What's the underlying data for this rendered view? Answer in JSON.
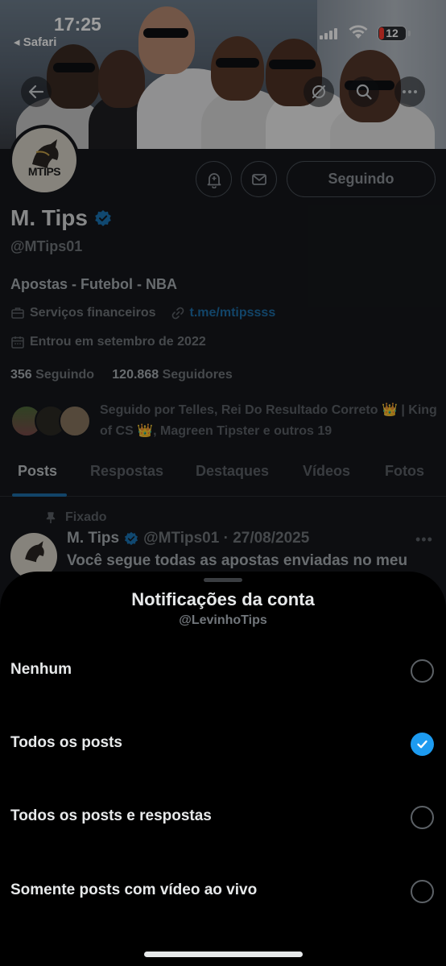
{
  "status_bar": {
    "time": "17:25",
    "back_app": "◂ Safari",
    "battery_level": "12"
  },
  "profile": {
    "avatar_text": "MTIPS",
    "display_name": "M. Tips",
    "handle": "@MTips01",
    "following_button": "Seguindo",
    "bio": "Apostas - Futebol - NBA",
    "category": "Serviços financeiros",
    "link": "t.me/mtipssss",
    "joined": "Entrou em setembro de 2022",
    "following_count": "356",
    "following_label": "Seguindo",
    "followers_count": "120.868",
    "followers_label": "Seguidores",
    "followed_by": "Seguido por Telles, Rei Do Resultado Correto 👑 | King of CS 👑, Magreen Tipster e outros 19"
  },
  "tabs": [
    "Posts",
    "Respostas",
    "Destaques",
    "Vídeos",
    "Fotos"
  ],
  "pinned_post": {
    "pinned_label": "Fixado",
    "author": "M. Tips",
    "meta": "@MTips01 · 27/08/2025",
    "text": "Você segue todas as apostas enviadas no meu"
  },
  "sheet": {
    "title": "Notificações da conta",
    "subtitle": "@LevinhoTips",
    "options": [
      {
        "label": "Nenhum",
        "checked": false
      },
      {
        "label": "Todos os posts",
        "checked": true
      },
      {
        "label": "Todos os posts e respostas",
        "checked": false
      },
      {
        "label": "Somente posts com vídeo ao vivo",
        "checked": false
      }
    ]
  },
  "colors": {
    "accent": "#1d9bf0",
    "background": "#000000"
  }
}
